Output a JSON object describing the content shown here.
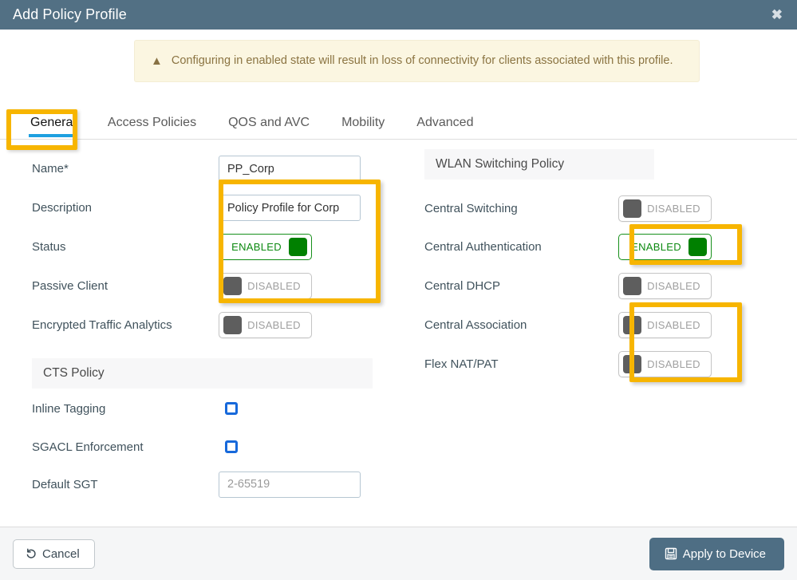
{
  "titlebar": {
    "title": "Add Policy Profile",
    "close_icon": "close-icon"
  },
  "warning": {
    "icon": "warning-triangle-icon",
    "text": "Configuring in enabled state will result in loss of connectivity for clients associated with this profile."
  },
  "tabs": [
    {
      "label": "General",
      "active": true
    },
    {
      "label": "Access Policies",
      "active": false
    },
    {
      "label": "QOS and AVC",
      "active": false
    },
    {
      "label": "Mobility",
      "active": false
    },
    {
      "label": "Advanced",
      "active": false
    }
  ],
  "left": {
    "fields": [
      {
        "label": "Name*",
        "type": "text",
        "value": "PP_Corp",
        "placeholder": ""
      },
      {
        "label": "Description",
        "type": "text",
        "value": "Policy Profile for Corp",
        "placeholder": ""
      },
      {
        "label": "Status",
        "type": "toggle",
        "state": "ENABLED"
      },
      {
        "label": "Passive Client",
        "type": "toggle",
        "state": "DISABLED"
      },
      {
        "label": "Encrypted Traffic Analytics",
        "type": "toggle",
        "state": "DISABLED"
      }
    ],
    "cts_section_title": "CTS Policy",
    "cts_fields": [
      {
        "label": "Inline Tagging",
        "type": "checkbox",
        "checked": false
      },
      {
        "label": "SGACL Enforcement",
        "type": "checkbox",
        "checked": false
      },
      {
        "label": "Default SGT",
        "type": "text",
        "value": "",
        "placeholder": "2-65519"
      }
    ]
  },
  "right": {
    "section_title": "WLAN Switching Policy",
    "fields": [
      {
        "label": "Central Switching",
        "type": "toggle",
        "state": "DISABLED"
      },
      {
        "label": "Central Authentication",
        "type": "toggle",
        "state": "ENABLED"
      },
      {
        "label": "Central DHCP",
        "type": "toggle",
        "state": "DISABLED"
      },
      {
        "label": "Central Association",
        "type": "toggle",
        "state": "DISABLED"
      },
      {
        "label": "Flex NAT/PAT",
        "type": "toggle",
        "state": "DISABLED"
      }
    ]
  },
  "footer": {
    "cancel_label": "Cancel",
    "cancel_icon": "undo-arrow-icon",
    "apply_label": "Apply to Device",
    "apply_icon": "save-disk-icon"
  },
  "colors": {
    "titlebar": "#527084",
    "highlight_yellow": "#f7b500",
    "toggle_on_green": "#008000",
    "toggle_off_gray": "#5e5e5e",
    "checkbox_blue": "#1769db",
    "warning_bg": "#fbf6e1",
    "warning_text": "#8b7442",
    "tab_underline_blue": "#1fa0e0",
    "apply_button": "#4e6e84"
  }
}
